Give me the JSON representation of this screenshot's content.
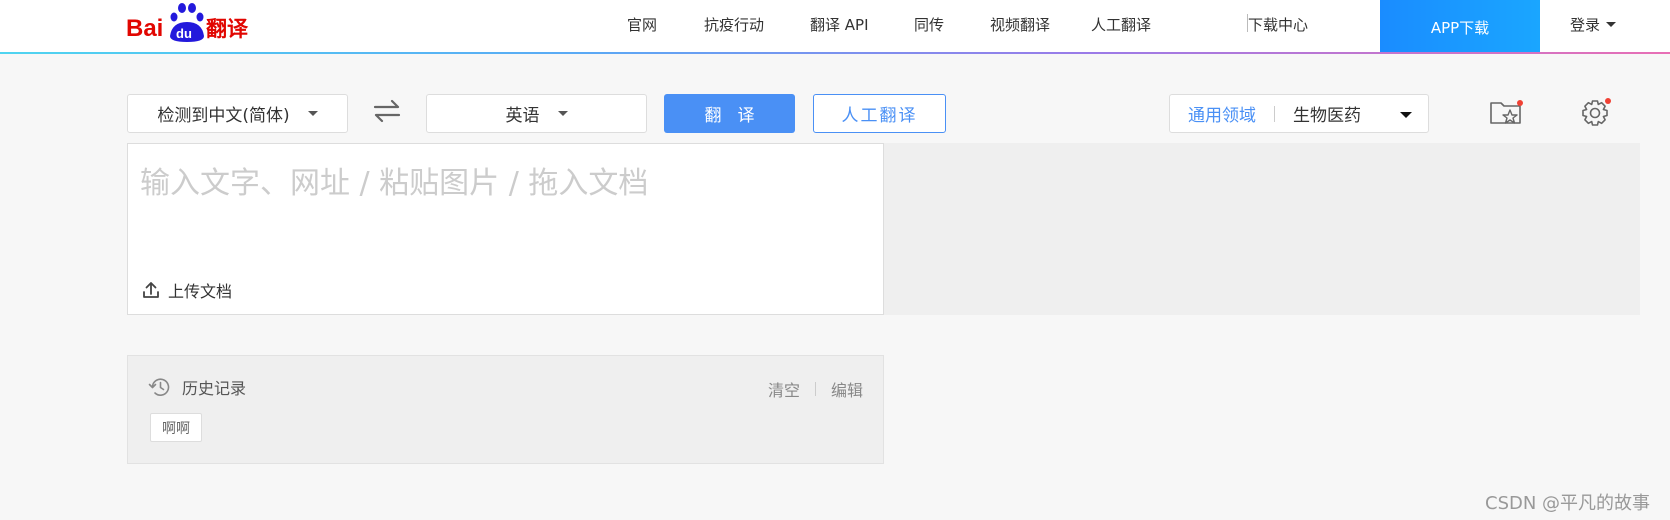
{
  "header": {
    "logo_text": "Bai du 翻译",
    "nav": [
      {
        "label": "官网"
      },
      {
        "label": "抗疫行动"
      },
      {
        "label": "翻译 API"
      },
      {
        "label": "同传"
      },
      {
        "label": "视频翻译"
      },
      {
        "label": "人工翻译"
      },
      {
        "label": "下载中心"
      }
    ],
    "app_download": "APP下载",
    "login": "登录"
  },
  "toolbar": {
    "source_lang": "检测到中文(简体)",
    "target_lang": "英语",
    "translate_button": "翻译",
    "human_translate_button": "人工翻译",
    "domain_general": "通用领域",
    "domain_selected": "生物医药"
  },
  "input": {
    "placeholder": "输入文字、网址 / 粘贴图片 / 拖入文档",
    "upload_label": "上传文档"
  },
  "history": {
    "title": "历史记录",
    "clear": "清空",
    "edit": "编辑",
    "items": [
      "啊啊"
    ]
  },
  "watermark": "CSDN @平凡的故事",
  "colors": {
    "accent": "#4a90f5",
    "app_download_bg": "#1a8cff",
    "logo_red": "#e10601",
    "logo_blue": "#2319dc",
    "notification_dot": "#f04134"
  }
}
